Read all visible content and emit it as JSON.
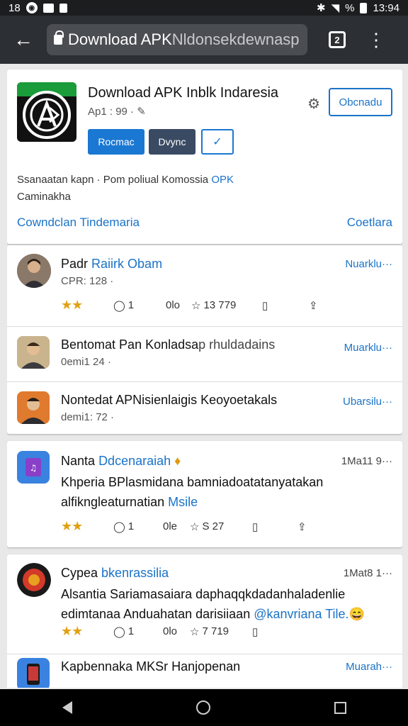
{
  "status": {
    "time_left": "18",
    "time_right": "13:94",
    "battery": "%"
  },
  "toolbar": {
    "url_bold": "Download APK ",
    "url_domain": "Nldonsekdewnasp",
    "tabs_count": "2"
  },
  "app": {
    "title": "Download APK Inblk Indaresia",
    "meta": "Ap1 : 99 · ",
    "outline_button": "Obcnadu",
    "primary_button": "Rocmac",
    "secondary_button": "Dvync",
    "check_button": "✓",
    "desc_line1": "Ssanaatan kapn · Pom poliual Komossia ",
    "desc_opk": "OPK",
    "desc_line2": "Caminakha",
    "link_left": "Cowndclan Tindemaria",
    "link_right": "Coetlara"
  },
  "feed": [
    {
      "name": "Padr",
      "name_blue": "Raiirk Obam",
      "sub": "CPR: 128 ·",
      "action": "Nuarklu···",
      "rating": "★★",
      "comments": "1",
      "shares": "0lo",
      "likes": "13 779"
    },
    {
      "name": "Bentomat Pan Konladsa",
      "name_extra": "p rhuldadains",
      "sub": "0emi1 24 ·",
      "action": "Muarklu···"
    },
    {
      "name": "Nontedat APNisienlaigis Keoyoetakals",
      "sub": "demi1: 72 ·",
      "action": "Ubarsilu···"
    }
  ],
  "posts": [
    {
      "name": "Nanta",
      "name_blue": "Ddcenaraiah",
      "time": "1Ma11 9···",
      "text1": "Khperia BPlasmidana bamniadoatatanyatakan",
      "text2": "alfikngleaturnatian ",
      "text2_blue": "Msile",
      "rating": "★★",
      "comments": "1",
      "shares": "0le",
      "likes": "S 27"
    },
    {
      "name": "Cypea",
      "name_blue": "bkenrassilia",
      "time": "1Mat8 1···",
      "text1": "Alsantia Sariamasaiara daphaqqkdadanhaladenlie",
      "text2": "edimtanaa Anduahatan darisiiaan ",
      "text2_blue": "@kanvriana Tile.",
      "rating": "★★",
      "comments": "1",
      "shares": "0lo",
      "likes": "7 719"
    },
    {
      "name": "Kapbennaka MKSr Hanjopenan",
      "action": "Muarah···"
    }
  ]
}
